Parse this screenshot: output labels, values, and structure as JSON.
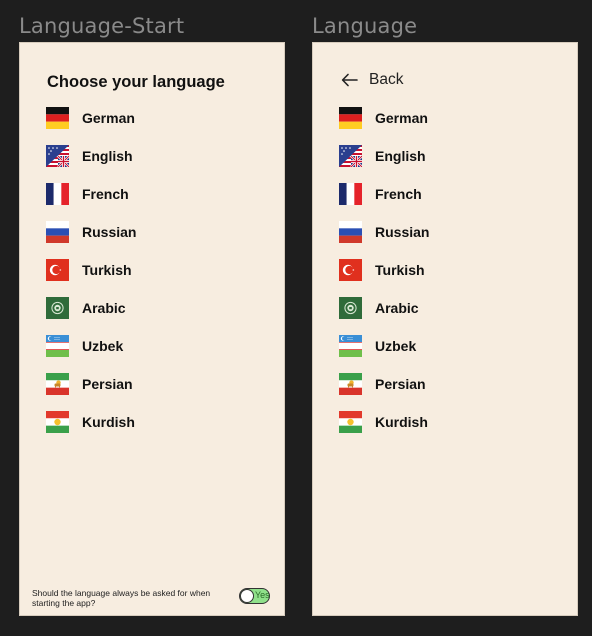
{
  "frames": {
    "left_title": "Language-Start",
    "right_title": "Language"
  },
  "start_screen": {
    "heading": "Choose your language",
    "footer_question": "Should the language always be asked for when starting the app?",
    "toggle": {
      "label": "Yes",
      "checked": true
    }
  },
  "settings_screen": {
    "back_label": "Back",
    "back_icon": "arrow-left-icon"
  },
  "languages": [
    {
      "label": "German",
      "icon": "flag-germany-icon"
    },
    {
      "label": "English",
      "icon": "flag-uk-us-icon"
    },
    {
      "label": "French",
      "icon": "flag-france-icon"
    },
    {
      "label": "Russian",
      "icon": "flag-russia-icon"
    },
    {
      "label": "Turkish",
      "icon": "flag-turkey-icon"
    },
    {
      "label": "Arabic",
      "icon": "flag-arab-league-icon"
    },
    {
      "label": "Uzbek",
      "icon": "flag-uzbekistan-icon"
    },
    {
      "label": "Persian",
      "icon": "flag-iran-lion-sun-icon"
    },
    {
      "label": "Kurdish",
      "icon": "flag-kurdistan-icon"
    }
  ]
}
